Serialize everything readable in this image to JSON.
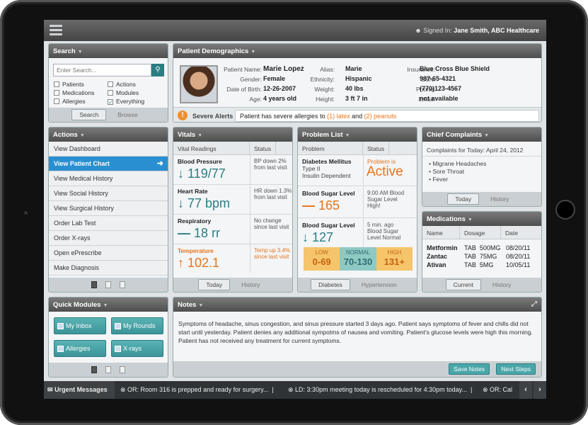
{
  "topbar": {
    "signed_in_label": "Signed In:",
    "user": "Jane Smith, ABC Healthcare"
  },
  "search": {
    "title": "Search",
    "placeholder": "Enter Search...",
    "options": [
      {
        "label": "Patients",
        "checked": false
      },
      {
        "label": "Actions",
        "checked": false
      },
      {
        "label": "Medications",
        "checked": false
      },
      {
        "label": "Modules",
        "checked": false
      },
      {
        "label": "Allergies",
        "checked": false
      },
      {
        "label": "Everything",
        "checked": true
      }
    ],
    "search_btn": "Search",
    "browse_btn": "Browse"
  },
  "actions": {
    "title": "Actions",
    "items": [
      "View Dashboard",
      "View Patient Chart",
      "View Medical History",
      "View Social History",
      "View Surgical History",
      "Order Lab Test",
      "Order X-rays",
      "Open ePrescribe",
      "Make Diagnosis"
    ],
    "selected_index": 1
  },
  "quick": {
    "title": "Quick Modules",
    "buttons": [
      "My Inbox",
      "My Rounds",
      "Allergies",
      "X-rays"
    ]
  },
  "demographics": {
    "title": "Patient Demographics",
    "fields": [
      {
        "label": "Patient Name:",
        "value": "Marie Lopez"
      },
      {
        "label": "Gender:",
        "value": "Female"
      },
      {
        "label": "Date of Birth:",
        "value": "12-26-2007"
      },
      {
        "label": "Age:",
        "value": "4 years old"
      },
      {
        "label": "Alias:",
        "value": "Marie"
      },
      {
        "label": "Ethnicity:",
        "value": "Hispanic"
      },
      {
        "label": "Weight:",
        "value": "40 lbs"
      },
      {
        "label": "Height:",
        "value": "3 ft 7 in"
      },
      {
        "label": "Insurance:",
        "value": "Blue Cross Blue Shield"
      },
      {
        "label": "SSN:",
        "value": "987-65-4321"
      },
      {
        "label": "Phone:",
        "value": "(770)123-4567"
      },
      {
        "label": "Email:",
        "value": "not available"
      }
    ],
    "alert_title": "Severe Alerts",
    "alert_text": "Patient has severe allergies to",
    "allergy1": "(1) latex",
    "and": "and",
    "allergy2": "(2) peanuts"
  },
  "vitals": {
    "title": "Vitals",
    "col1": "Vital Readings",
    "col2": "Status",
    "rows": [
      {
        "name": "Blood Pressure",
        "value": "119/77",
        "arrow": "↓",
        "status": "BP down 2% from last visit",
        "color": "#2c7d83"
      },
      {
        "name": "Heart Rate",
        "value": "77 bpm",
        "arrow": "↓",
        "status": "HR down 1.3% from last visit",
        "color": "#2c7d83"
      },
      {
        "name": "Respiratory",
        "value": "18 rr",
        "arrow": "—",
        "status": "No change since last visit",
        "color": "#2c7d83"
      },
      {
        "name": "Temperature",
        "value": "102.1",
        "arrow": "↑",
        "status": "Temp up 3.4% since last visit",
        "color": "#e8731a"
      }
    ],
    "tab_today": "Today",
    "tab_history": "History"
  },
  "problems": {
    "title": "Problem List",
    "col1": "Problem",
    "col2": "Status",
    "p1_name": "Diabetes Mellitus",
    "p1_sub": "Type II",
    "p1_sub2": "Insulin Dependent",
    "p1_status_label": "Problem is",
    "p1_status": "Active",
    "p2_name": "Blood Sugar Level",
    "p2_value": "165",
    "p2_arrow": "—",
    "p2_status": "9:00 AM Blood Sugar Level High!",
    "p3_name": "Blood Sugar Level",
    "p3_value": "127",
    "p3_arrow": "↓",
    "p3_status": "5 min. ago Blood Sugar Level Normal",
    "scale": [
      {
        "label": "LOW",
        "range": "0-69",
        "bg": "#f5c46b"
      },
      {
        "label": "NORMAL",
        "range": "70-130",
        "bg": "#8fc9c4"
      },
      {
        "label": "HIGH",
        "range": "131+",
        "bg": "#f5c46b"
      }
    ],
    "tab1": "Diabetes",
    "tab2": "Hypertension"
  },
  "complaints": {
    "title": "Chief Complaints",
    "subtitle": "Complaints for Today: April 24, 2012",
    "items": [
      "• Migrane Headaches",
      "• Sore Throat",
      "• Fever"
    ],
    "tab_today": "Today",
    "tab_history": "History"
  },
  "medications": {
    "title": "Medications",
    "headers": [
      "Name",
      "Dosage",
      "Date"
    ],
    "rows": [
      {
        "name": "Metformin",
        "dose": "TAB  500MG",
        "date": "08/20/11"
      },
      {
        "name": "Zantac",
        "dose": "TAB  75MG",
        "date": "08/20/11"
      },
      {
        "name": "Ativan",
        "dose": "TAB  5MG",
        "date": "10/05/11"
      }
    ],
    "tab_current": "Current",
    "tab_history": "History"
  },
  "notes": {
    "title": "Notes",
    "text": "Symptoms of headache, sinus congestion, and sinus pressure started 3 days ago. Patient says symptoms of fever and chills did not start until yesterday. Patient denies any additional sympotms of nausea and vomiting. Patient's glucose levels were high this morning. Patient has not received any treatment for current symptoms.",
    "save": "Save Notes",
    "next": "Next Steps"
  },
  "ticker": {
    "label": "Urgent Messages",
    "messages": [
      "OR: Room 316 is prepped and ready for surgery...",
      "LD: 3:30pm meeting today is rescheduled for 4:30pm today...",
      "OR: Cal"
    ]
  }
}
